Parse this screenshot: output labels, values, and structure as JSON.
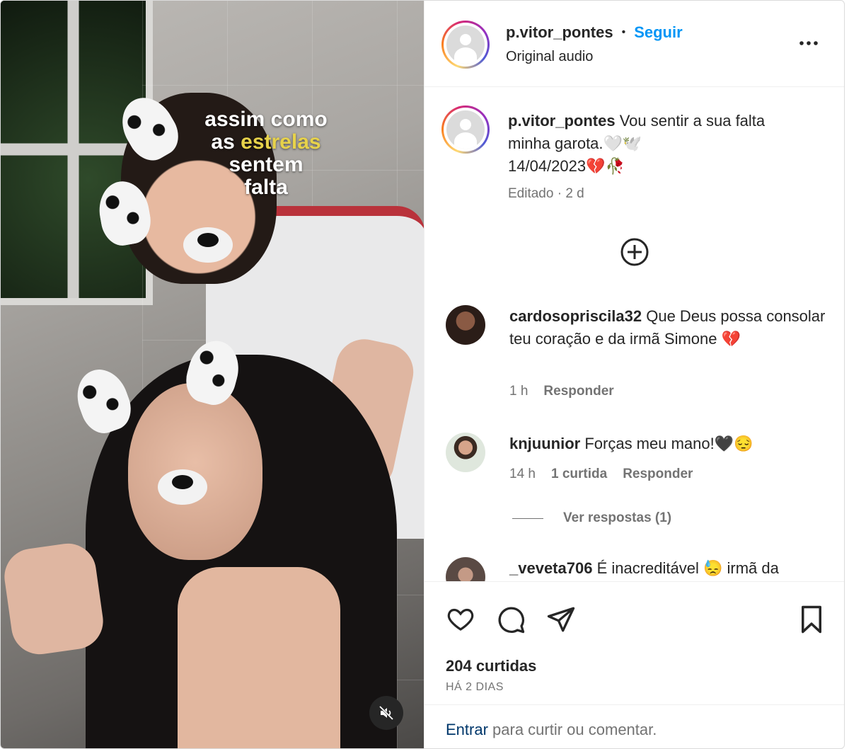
{
  "post": {
    "username": "p.vitor_pontes",
    "dot": "•",
    "follow_label": "Seguir",
    "audio_label": "Original audio",
    "more_icon": "more-horizontal-icon"
  },
  "media": {
    "overlay_line1": "assim como",
    "overlay_line2a": "as ",
    "overlay_line2b": "estrelas",
    "overlay_line3": "sentem",
    "overlay_line4": "falta",
    "mute_icon": "speaker-muted-icon",
    "colors": {
      "highlight": "#e7d24a"
    }
  },
  "caption": {
    "username": "p.vitor_pontes",
    "text1": " Vou sentir a sua falta",
    "text2": "minha garota.🤍🕊️",
    "text3": "14/04/2023💔🥀",
    "edited": "Editado · 2 d"
  },
  "load_more_icon": "plus-circle-icon",
  "comments": [
    {
      "username": "cardosopriscila32",
      "text": " Que Deus possa consolar teu coração e da irmã Simone 💔",
      "time": "1 h",
      "reply": "Responder",
      "likes": ""
    },
    {
      "username": "knjuunior",
      "text": " Forças meu mano!🖤😔",
      "time": "14 h",
      "likes": "1 curtida",
      "reply": "Responder",
      "view_replies": "Ver respostas (1)"
    },
    {
      "username": "_veveta706",
      "text": " É inacreditável 😓 irmã da"
    }
  ],
  "actions": {
    "like_icon": "heart-icon",
    "comment_icon": "comment-icon",
    "share_icon": "send-icon",
    "save_icon": "bookmark-icon",
    "likes": "204 curtidas",
    "date": "HÁ 2 DIAS"
  },
  "login": {
    "link": "Entrar",
    "text": " para curtir ou comentar."
  },
  "colors": {
    "accent": "#0095f6",
    "link": "#00376b",
    "muted": "#737373"
  }
}
